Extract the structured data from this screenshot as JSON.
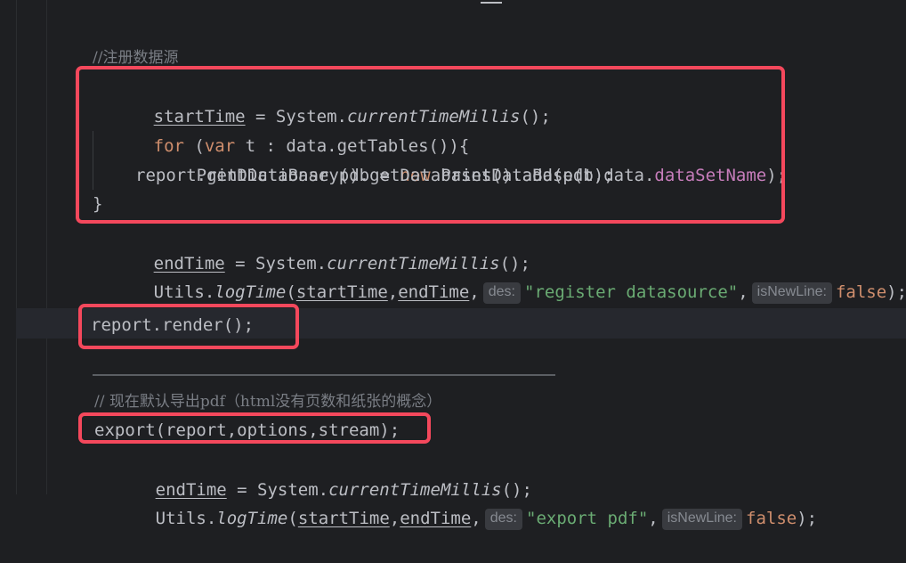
{
  "editor": {
    "lines": {
      "comment_register": "//注册数据源",
      "start_time": {
        "var": "startTime",
        "op": " = System.",
        "method": "currentTimeMillis",
        "tail": "();"
      },
      "for_loop": {
        "kw_for": "for",
        "open": " (",
        "kw_var": "var",
        "rest": " t : data.getTables()){"
      },
      "print_db": {
        "pre": "PrintDataBase pdb = ",
        "kw_new": "new",
        "mid": " PrintDataBase(t,data.",
        "field": "dataSetName",
        "tail": ");"
      },
      "add_db": "report.getDictionary().getDatabases().add(pdb);",
      "close_brace": "}",
      "end_time": {
        "var": "endTime",
        "op": " = System.",
        "method": "currentTimeMillis",
        "tail": "();"
      },
      "log_time_1": {
        "pre": "Utils.",
        "method": "logTime",
        "open": "(",
        "a1": "startTime",
        "comma": ",",
        "a2": "endTime",
        "comma2": ",",
        "hint_des": "des:",
        "str": "\"register datasource\"",
        "comma3": ",",
        "hint_newline": "isNewLine:",
        "kw_false": "false",
        "tail": ");"
      },
      "render": "report.render();",
      "comment_default": "// 现在默认导出pdf（html没有页数和纸张的概念）",
      "export": "export(report,options,stream);",
      "end_time_2": {
        "var": "endTime",
        "op": " = System.",
        "method": "currentTimeMillis",
        "tail": "();"
      },
      "log_time_2": {
        "pre": "Utils.",
        "method": "logTime",
        "open": "(",
        "a1": "startTime",
        "comma": ",",
        "a2": "endTime",
        "comma2": ",",
        "hint_des": "des:",
        "str": "\"export pdf\"",
        "comma3": ",",
        "hint_newline": "isNewLine:",
        "kw_false": "false",
        "tail": ");"
      }
    }
  },
  "colors": {
    "background": "#1e1f22",
    "keyword": "#cf8e6d",
    "field": "#c77dbb",
    "string": "#6aab73",
    "comment": "#7a7e85",
    "highlight_box": "#f4485c"
  }
}
